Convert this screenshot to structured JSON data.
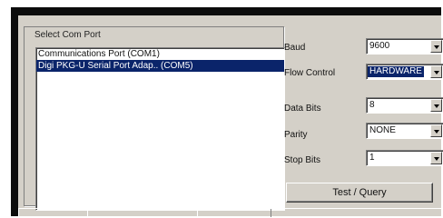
{
  "port_group": {
    "label": "Select Com Port",
    "ports": [
      {
        "label": "Communications Port (COM1)",
        "selected": false
      },
      {
        "label": "Digi PKG-U Serial Port Adap.. (COM5)",
        "selected": true
      }
    ]
  },
  "settings": {
    "baud": {
      "label": "Baud",
      "value": "9600"
    },
    "flow_control": {
      "label": "Flow Control",
      "value": "HARDWARE"
    },
    "data_bits": {
      "label": "Data Bits",
      "value": "8"
    },
    "parity": {
      "label": "Parity",
      "value": "NONE"
    },
    "stop_bits": {
      "label": "Stop Bits",
      "value": "1"
    }
  },
  "test_button": {
    "label": "Test / Query"
  },
  "colors": {
    "selection": "#0a246a",
    "panel": "#d4d0c8"
  }
}
